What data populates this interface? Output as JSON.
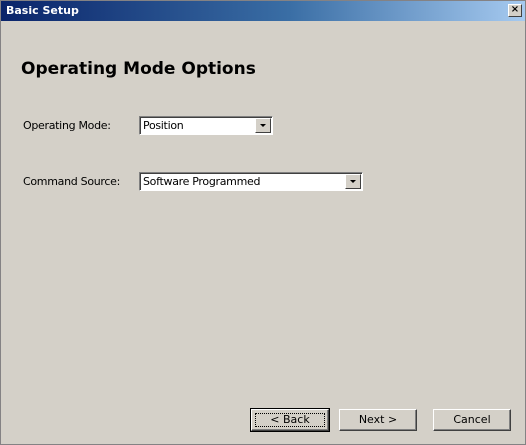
{
  "window": {
    "title": "Basic Setup",
    "close_symbol": "×",
    "close_icon": "close-icon"
  },
  "page": {
    "heading": "Operating Mode Options"
  },
  "fields": {
    "operating_mode": {
      "label": "Operating Mode:",
      "value": "Position"
    },
    "command_source": {
      "label": "Command Source:",
      "value": "Software Programmed"
    }
  },
  "buttons": {
    "back": "< Back",
    "next": "Next >",
    "cancel": "Cancel"
  },
  "colors": {
    "face": "#d4d0c8",
    "title_start": "#0a246a",
    "title_end": "#a6caf0"
  }
}
